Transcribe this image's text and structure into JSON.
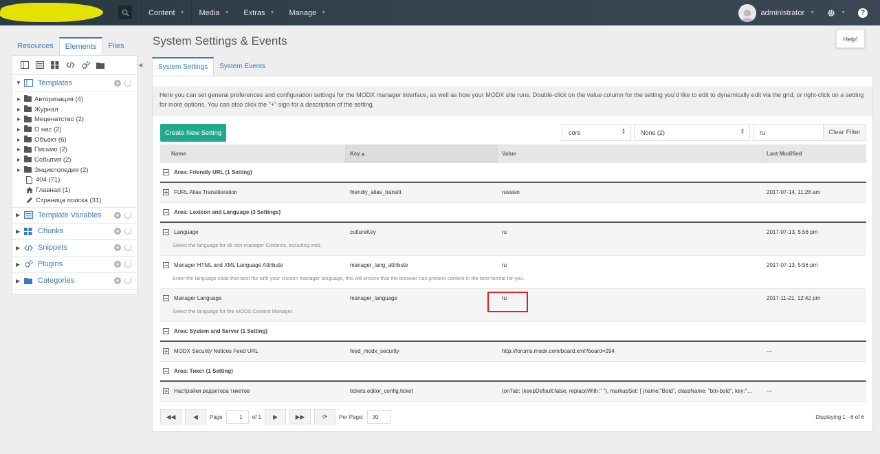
{
  "topnav": {
    "menu": [
      "Content",
      "Media",
      "Extras",
      "Manage"
    ],
    "user": "administrator",
    "help_icon": "?"
  },
  "left": {
    "tabs": [
      "Resources",
      "Elements",
      "Files"
    ],
    "templates_label": "Templates",
    "tree": [
      {
        "label": "Авторизация (4)",
        "type": "folder"
      },
      {
        "label": "Журнал",
        "type": "folder"
      },
      {
        "label": "Меценатство (2)",
        "type": "folder"
      },
      {
        "label": "О нас (2)",
        "type": "folder"
      },
      {
        "label": "Объект (6)",
        "type": "folder"
      },
      {
        "label": "Письмо (2)",
        "type": "folder"
      },
      {
        "label": "События (2)",
        "type": "folder"
      },
      {
        "label": "Энциклопедия (2)",
        "type": "folder"
      },
      {
        "label": "404 (71)",
        "type": "file-icon"
      },
      {
        "label": "Главная (1)",
        "type": "home-icon"
      },
      {
        "label": "Страница поиска (31)",
        "type": "pencil-icon"
      }
    ],
    "sections": [
      "Template Variables",
      "Chunks",
      "Snippets",
      "Plugins",
      "Categories"
    ]
  },
  "main": {
    "title": "System Settings & Events",
    "help_button": "Help!",
    "tabs": [
      "System Settings",
      "System Events"
    ],
    "description": "Here you can set general preferences and configuration settings for the MODX manager interface, as well as how your MODX site runs. Double-click on the value column for the setting you'd like to edit to dynamically edit via the grid, or right-click on a setting for more options. You can also click the \"+\" sign for a description of the setting.",
    "create_button": "Create New Setting",
    "namespace_select": "core",
    "area_select": "None (2)",
    "search_value": "ru",
    "clear_filter": "Clear Filter",
    "columns": [
      "Name",
      "Key ▴",
      "Value",
      "Last Modified"
    ],
    "areas": [
      "Area: Friendly URL (1 Setting)",
      "Area: Lexicon and Language (3 Settings)",
      "Area: System and Server (1 Setting)",
      "Area: Тикет (1 Setting)"
    ],
    "rows": [
      {
        "name": "FURL Alias Transliteration",
        "key": "friendly_alias_translit",
        "value": "russian",
        "modified": "2017-07-14, 11:28 am",
        "desc": ""
      },
      {
        "name": "Language",
        "key": "cultureKey",
        "value": "ru",
        "modified": "2017-07-13, 5:56 pm",
        "desc": "Select the language for all non-manager Contexts, including web."
      },
      {
        "name": "Manager HTML and XML Language Attribute",
        "key": "manager_lang_attribute",
        "value": "ru",
        "modified": "2017-07-13, 5:56 pm",
        "desc": "Enter the language code that best fits with your chosen manager language, this will ensure that the browser can present content in the best format for you."
      },
      {
        "name": "Manager Language",
        "key": "manager_language",
        "value": "ru",
        "modified": "2017-11-21, 12:42 pm",
        "desc": "Select the language for the MODX Content Manager."
      },
      {
        "name": "MODX Security Notices Feed URL",
        "key": "feed_modx_security",
        "value": "http://forums.modx.com/board.xml?board=294",
        "modified": "—",
        "desc": ""
      },
      {
        "name": "Настройки редактора тикетов",
        "key": "tickets.editor_config.ticket",
        "value": "{onTab: {keepDefault:false, replaceWith:\" \"}, markupSet: [ {name:\"Bold\", className: \"btn-bold\", key:\"…",
        "modified": "—",
        "desc": ""
      }
    ],
    "pager": {
      "page_label": "Page",
      "page_value": "1",
      "of_label": "of 1",
      "per_page_label": "Per Page:",
      "per_page_value": "30",
      "displaying": "Displaying 1 - 6 of 6"
    }
  }
}
